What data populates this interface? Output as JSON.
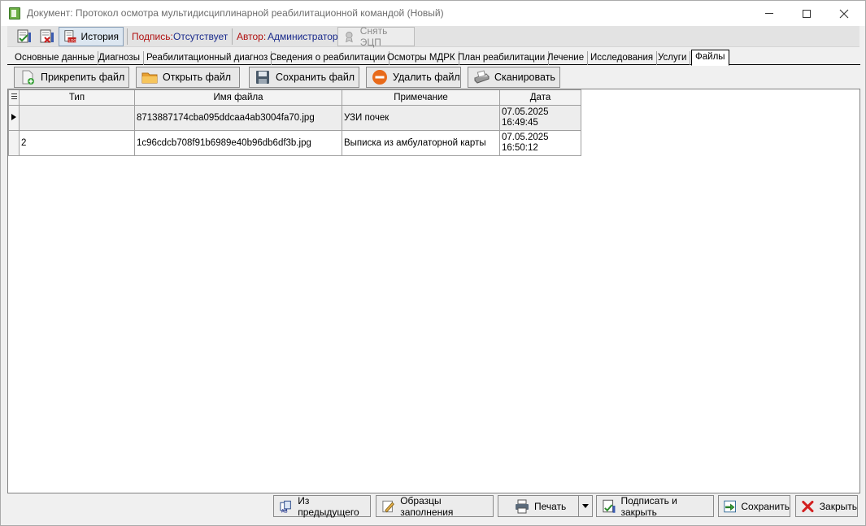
{
  "window": {
    "title": "Документ: Протокол осмотра мультидисциплинарной реабилитационной командой (Новый)",
    "icon": "document-green-icon"
  },
  "toolbar": {
    "history_label": "История",
    "signature_label": "Подпись:",
    "signature_value": "Отсутствует",
    "author_label": "Автор:",
    "author_value": "Администратор",
    "remove_ecp_label": "Снять ЭЦП"
  },
  "tabs": [
    {
      "label": "Основные данные"
    },
    {
      "label": "Диагнозы"
    },
    {
      "label": "Реабилитационный диагноз"
    },
    {
      "label": "Сведения о реабилитации"
    },
    {
      "label": "Осмотры МДРК"
    },
    {
      "label": "План реабилитации"
    },
    {
      "label": "Лечение"
    },
    {
      "label": "Исследования"
    },
    {
      "label": "Услуги"
    },
    {
      "label": "Файлы"
    }
  ],
  "active_tab": "Файлы",
  "file_actions": {
    "attach": "Прикрепить файл",
    "open": "Открыть файл",
    "save": "Сохранить файл",
    "delete": "Удалить файл",
    "scan": "Сканировать"
  },
  "grid": {
    "columns": [
      "Тип",
      "Имя файла",
      "Примечание",
      "Дата"
    ],
    "rows": [
      {
        "type": "",
        "filename": "8713887174cba095ddcaa4ab3004fa70.jpg",
        "note": "УЗИ почек",
        "date": "07.05.2025",
        "time": "16:49:45"
      },
      {
        "type": "2",
        "filename": "1c96cdcb708f91b6989e40b96db6df3b.jpg",
        "note": "Выписка из амбулаторной карты",
        "date": "07.05.2025",
        "time": "16:50:12"
      }
    ]
  },
  "bottom": {
    "from_previous": "Из предыдущего",
    "templates": "Образцы заполнения",
    "print": "Печать",
    "sign_close": "Подписать и закрыть",
    "save": "Сохранить",
    "close": "Закрыть"
  },
  "colors": {
    "signature_label": "#b01010",
    "signature_value": "#1a2b8c",
    "delete_icon": "#e86a1a",
    "close_icon": "#d21f1f"
  }
}
